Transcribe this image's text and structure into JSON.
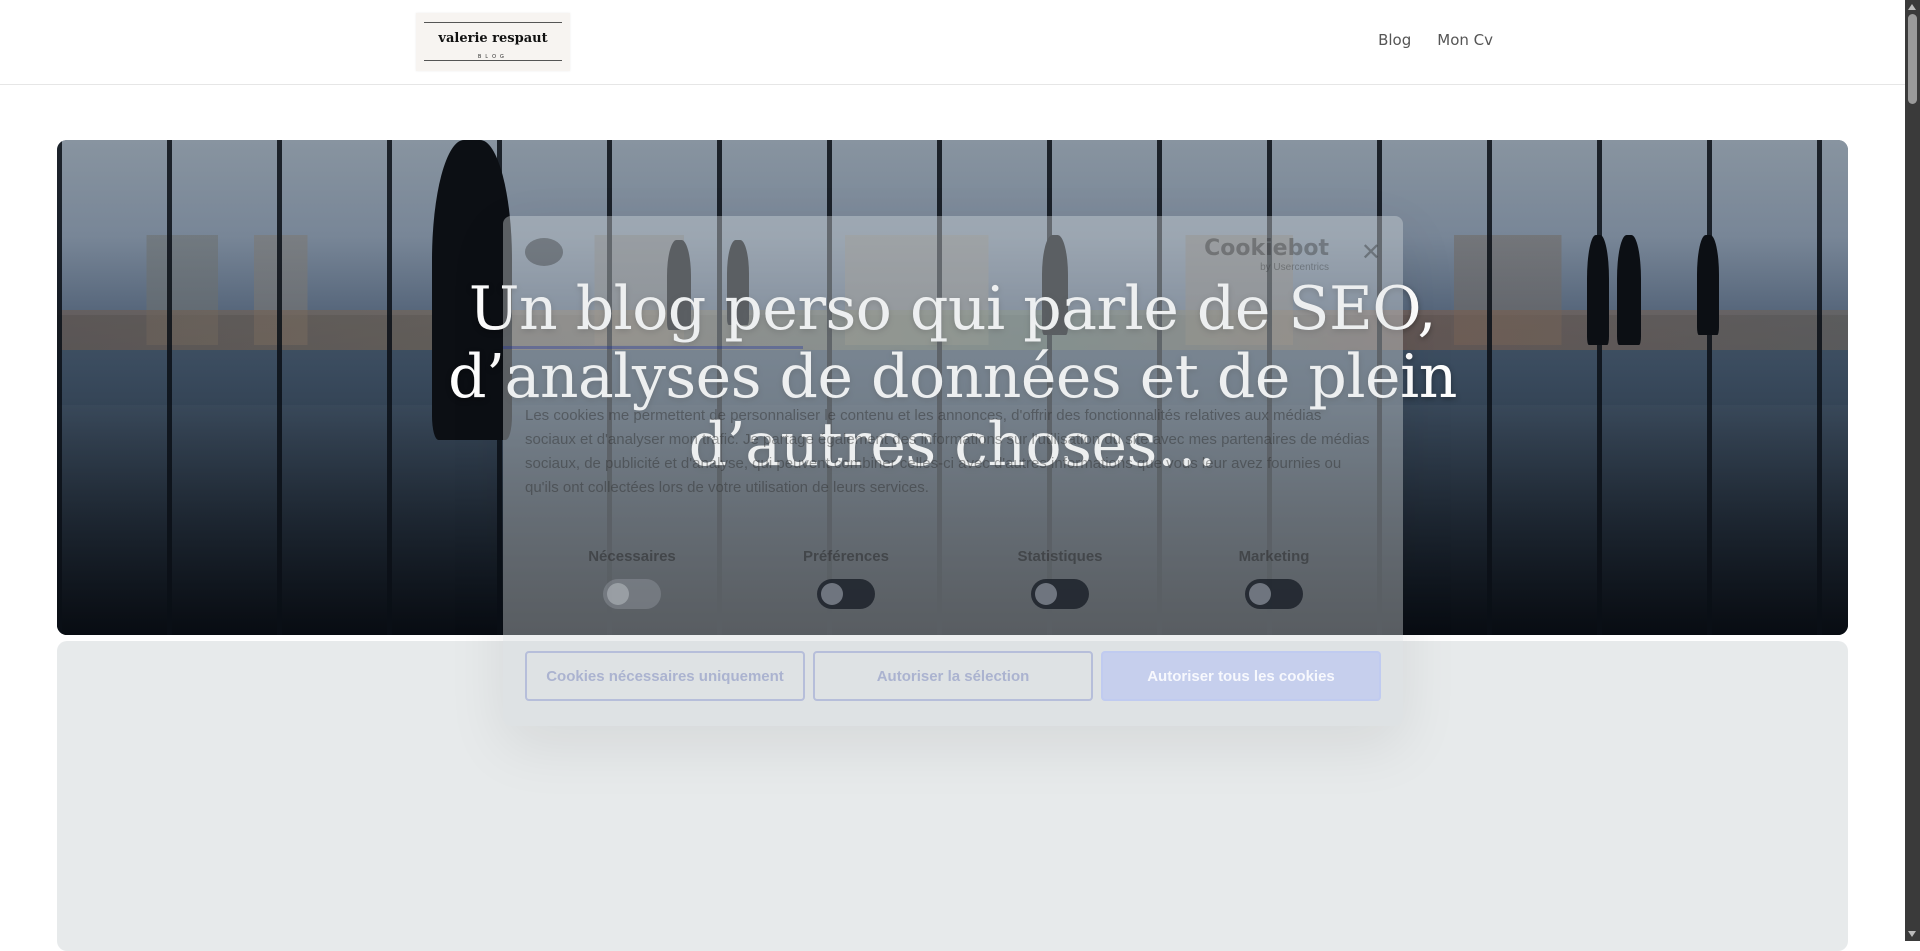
{
  "header": {
    "logo": {
      "name": "valerie respaut",
      "sub": "BLOG"
    },
    "nav": [
      {
        "label": "Blog"
      },
      {
        "label": "Mon Cv"
      }
    ]
  },
  "hero": {
    "headline_line1": "Un blog perso qui parle de SEO,",
    "headline_line2": "d’analyses de données et de plein",
    "headline_line3": "d’autres choses…"
  },
  "cookie": {
    "brand": "Cookiebot",
    "brand_sub": "by Usercentrics",
    "close": "✕",
    "text": "Les cookies me permettent de personnaliser le contenu et les annonces, d'offrir des fonctionnalités relatives aux médias sociaux et d'analyser mon trafic. Je partage également des informations sur l'utilisation du site avec mes partenaires de médias sociaux, de publicité et d'analyse, qui peuvent combiner celles-ci avec d'autres informations que vous leur avez fournies ou qu'ils ont collectées lors de votre utilisation de leurs services.",
    "categories": [
      {
        "label": "Nécessaires"
      },
      {
        "label": "Préférences"
      },
      {
        "label": "Statistiques"
      },
      {
        "label": "Marketing"
      }
    ],
    "buttons": {
      "necessary": "Cookies nécessaires uniquement",
      "selection": "Autoriser la sélection",
      "all": "Autoriser tous les cookies"
    }
  },
  "colors": {
    "nav_text": "#555555",
    "hero_text": "#ffffff",
    "section_bg": "#e7eaeb"
  }
}
